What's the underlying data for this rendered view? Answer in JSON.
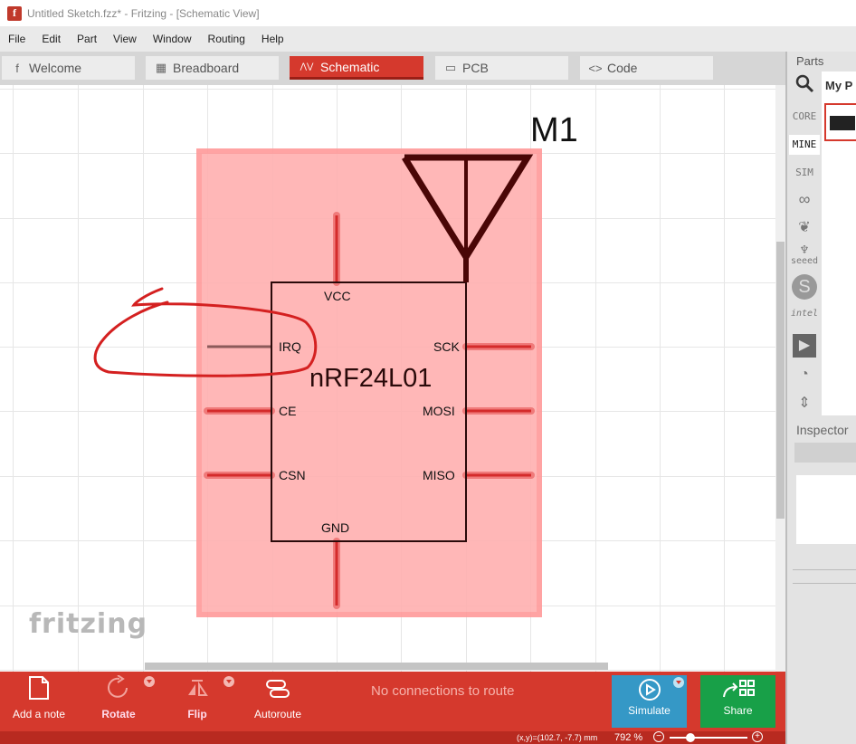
{
  "window": {
    "title": "Untitled Sketch.fzz* - Fritzing - [Schematic View]",
    "app_icon_letter": "f"
  },
  "menu": [
    "File",
    "Edit",
    "Part",
    "View",
    "Window",
    "Routing",
    "Help"
  ],
  "tabs": [
    {
      "label": "Welcome",
      "icon": "fritzing-f-icon",
      "glyph": "f",
      "active": false
    },
    {
      "label": "Breadboard",
      "icon": "breadboard-icon",
      "glyph": "▦",
      "active": false
    },
    {
      "label": "Schematic",
      "icon": "schematic-icon",
      "glyph": "⋀⋁",
      "active": true
    },
    {
      "label": "PCB",
      "icon": "pcb-icon",
      "glyph": "▭",
      "active": false
    },
    {
      "label": "Code",
      "icon": "code-icon",
      "glyph": "<>",
      "active": false
    }
  ],
  "schematic": {
    "part_label": "M1",
    "part_name": "nRF24L01",
    "pins": {
      "vcc": "VCC",
      "irq": "IRQ",
      "ce": "CE",
      "csn": "CSN",
      "gnd": "GND",
      "sck": "SCK",
      "mosi": "MOSI",
      "miso": "MISO"
    },
    "selection_color": "#ff9a9a",
    "pin_color": "#d42b2b"
  },
  "logo": "fritzing",
  "toolbar": {
    "add_note": "Add a note",
    "rotate": "Rotate",
    "flip": "Flip",
    "autoroute": "Autoroute",
    "route_status": "No connections to route",
    "simulate": "Simulate",
    "share": "Share"
  },
  "status": {
    "coords": "(x,y)=(102.7, -7.7) mm",
    "zoom": "792 %",
    "zoom_level": 0.27
  },
  "parts_panel": {
    "title": "Parts",
    "bin_title": "My P",
    "bins": {
      "core": "CORE",
      "mine": "MINE",
      "sim": "SIM",
      "seeed": "seeed",
      "intel": "intel"
    }
  },
  "inspector": {
    "title": "Inspector"
  },
  "colors": {
    "accent": "#d5392d",
    "simulate": "#3598c6",
    "share": "#18a048"
  }
}
